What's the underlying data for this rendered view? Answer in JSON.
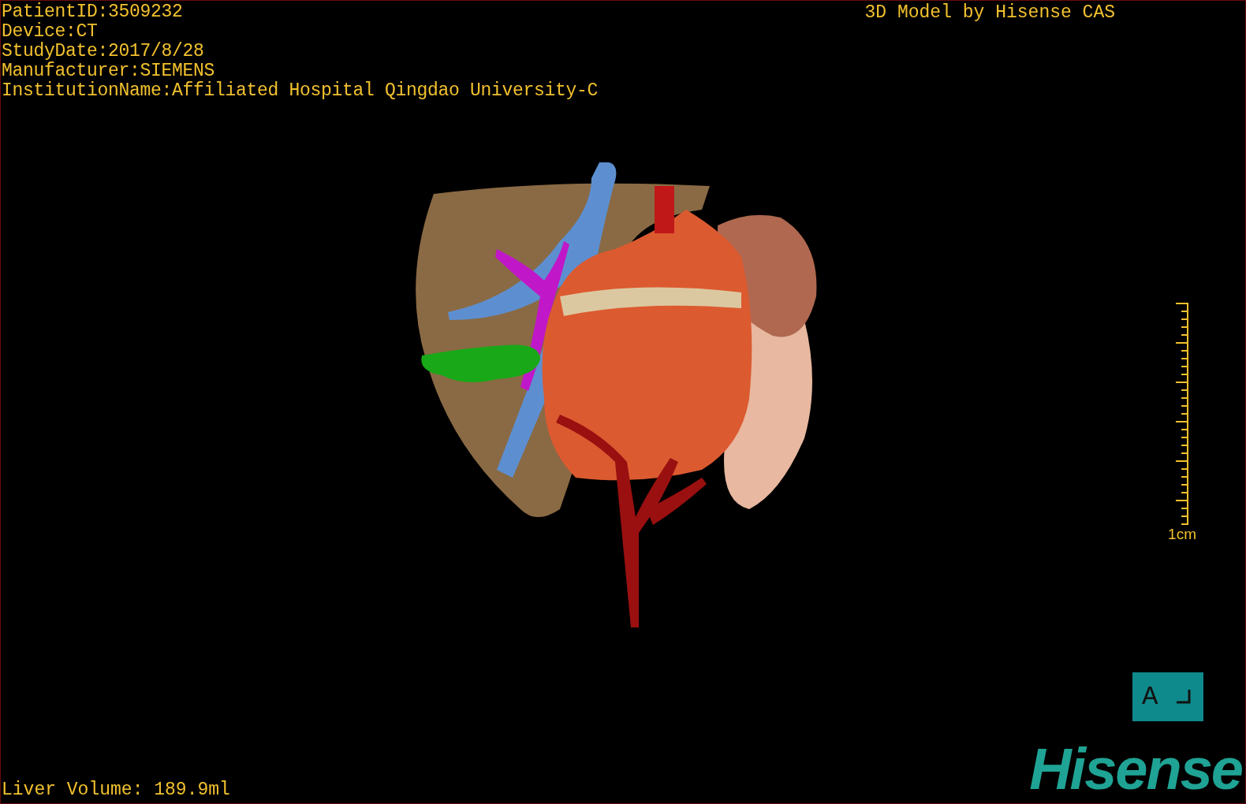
{
  "info_lines": [
    "PatientID:3509232",
    "Device:CT",
    "StudyDate:2017/8/28",
    "Manufacturer:SIEMENS",
    "InstitutionName:Affiliated Hospital Qingdao University-C"
  ],
  "title": "3D Model by Hisense CAS",
  "scale_bar": {
    "label": "1cm"
  },
  "volume": "Liver Volume: 189.9ml",
  "orientation": {
    "label": "A"
  },
  "logo": "Hisense"
}
